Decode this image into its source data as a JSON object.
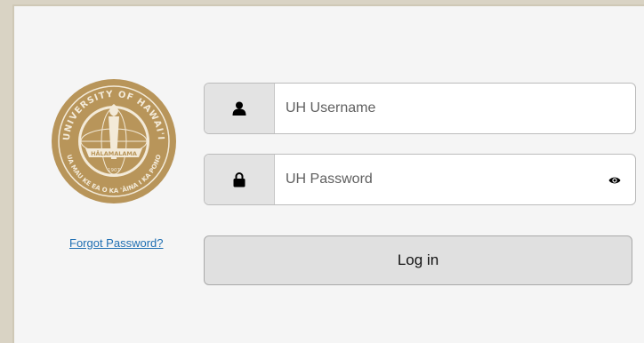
{
  "seal": {
    "top_text": "UNIVERSITY OF HAWAI'I",
    "bottom_text": "UA MAU KE EA O KA 'ĀINA I KA PONO",
    "banner_text": "HĀLAMALAMA",
    "year": "1907",
    "color": "#b8955a"
  },
  "links": {
    "forgot_password": "Forgot Password?"
  },
  "username": {
    "placeholder": "UH Username",
    "icon": "user-icon"
  },
  "password": {
    "placeholder": "UH Password",
    "icon": "lock-icon",
    "toggle_icon": "eye-icon"
  },
  "login_button": {
    "label": "Log in"
  },
  "colors": {
    "link": "#1f6fb3",
    "addon_bg": "#e3e3e3",
    "button_bg": "#e0e0e0"
  }
}
